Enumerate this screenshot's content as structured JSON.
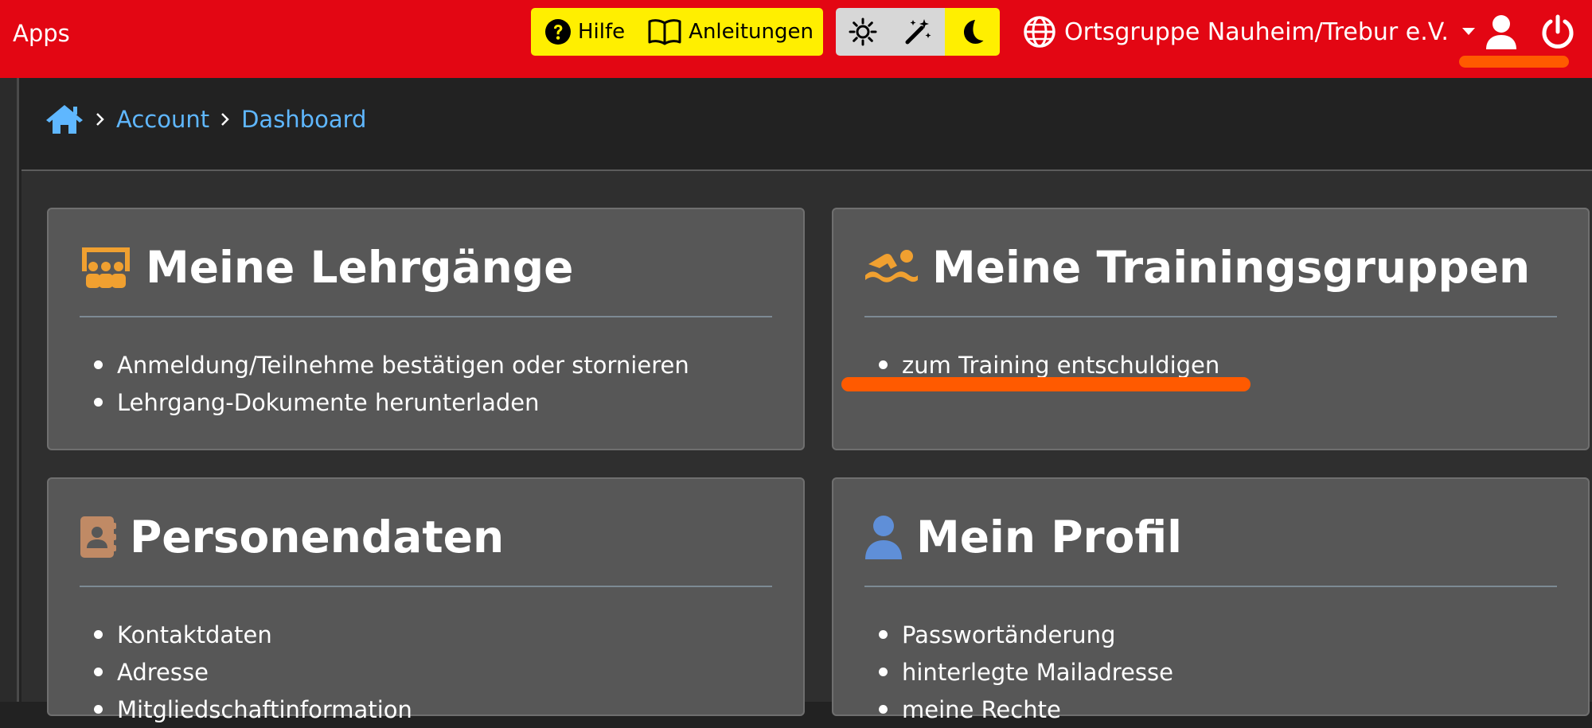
{
  "navbar": {
    "brand": "Apps",
    "help_label": "Hilfe",
    "guides_label": "Anleitungen",
    "theme_buttons": [
      {
        "icon": "sun-icon"
      },
      {
        "icon": "magic-wand-icon"
      },
      {
        "icon": "moon-icon",
        "active": true
      }
    ],
    "org_name": "Ortsgruppe Nauheim/Trebur e.V.",
    "colors": {
      "bar": "#e30613",
      "help_group": "#ffef00",
      "theme_inactive": "#d7d7d7",
      "annotation": "#ff5a00"
    }
  },
  "breadcrumb": {
    "items": [
      "Account",
      "Dashboard"
    ],
    "link_color": "#5fb7ff"
  },
  "cards": {
    "lehrgaenge": {
      "title": "Meine Lehrgänge",
      "icon": "chalkboard-teacher-icon",
      "icon_color": "#f0a030",
      "items": [
        "Anmeldung/Teilnehme bestätigen oder stornieren",
        "Lehrgang-Dokumente herunterladen"
      ]
    },
    "training": {
      "title": "Meine Trainingsgruppen",
      "icon": "swimmer-icon",
      "icon_color": "#f0a030",
      "items": [
        "zum Training entschuldigen"
      ]
    },
    "personendaten": {
      "title": "Personendaten",
      "icon": "address-book-icon",
      "icon_color": "#c08a65",
      "items": [
        "Kontaktdaten",
        "Adresse",
        "Mitgliedschaftinformation"
      ]
    },
    "profil": {
      "title": "Mein Profil",
      "icon": "user-icon",
      "icon_color": "#5f8fd8",
      "items": [
        "Passwortänderung",
        "hinterlegte Mailadresse",
        "meine Rechte"
      ]
    }
  }
}
